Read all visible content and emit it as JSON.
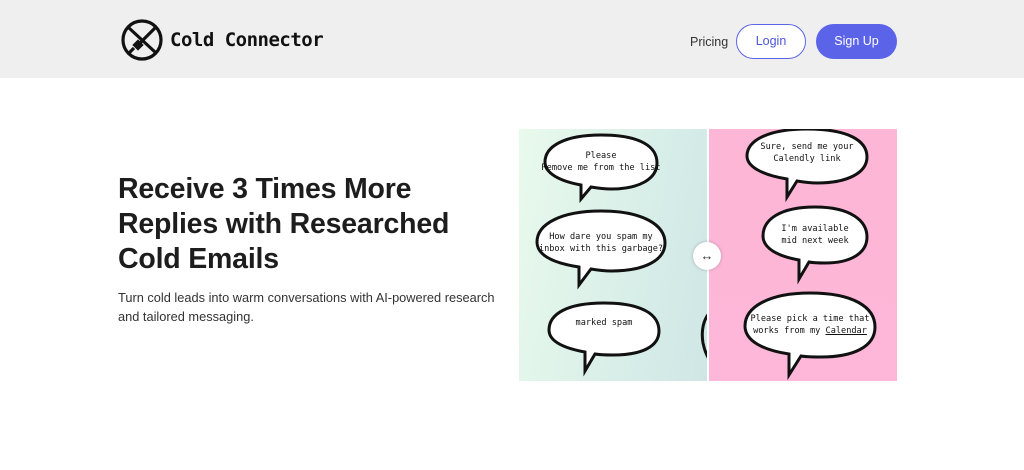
{
  "header": {
    "brand": "Cold Connector",
    "nav": {
      "pricing": "Pricing",
      "login": "Login",
      "signup": "Sign Up"
    },
    "colors": {
      "background": "#efefef",
      "accent": "#5b64e8"
    }
  },
  "hero": {
    "title": "Receive 3 Times More Replies with Researched Cold Emails",
    "subtitle": "Turn cold leads into warm conversations with AI-powered research and tailored messaging."
  },
  "comparison": {
    "handle_glyph": "↔",
    "left": {
      "background": "#dff3ea",
      "bubbles": [
        {
          "line1": "Please",
          "line2": "Remove me from the list"
        },
        {
          "line1": "How dare you spam my",
          "line2": "inbox with this garbage?"
        },
        {
          "line1": "marked spam"
        }
      ]
    },
    "right": {
      "background": "#feb7d8",
      "bubbles": [
        {
          "line1": "Sure, send me your",
          "line2": "Calendly link"
        },
        {
          "line1": "I'm available",
          "line2": "mid next week"
        },
        {
          "line1": "Please pick a time that",
          "line2": "works from my ",
          "link": "Calendar"
        }
      ]
    }
  }
}
